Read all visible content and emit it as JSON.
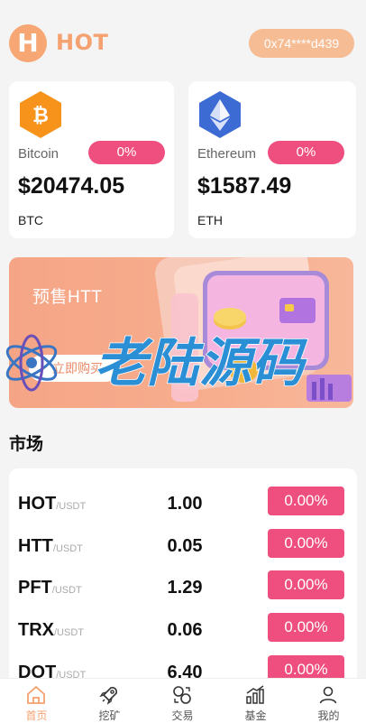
{
  "header": {
    "logo_letter": "H",
    "brand": "HOT",
    "wallet_address": "0x74****d439"
  },
  "coins": [
    {
      "name": "Bitcoin",
      "change": "0%",
      "price": "$20474.05",
      "symbol": "BTC",
      "icon": "bitcoin-icon",
      "color": "#f7931a"
    },
    {
      "name": "Ethereum",
      "change": "0%",
      "price": "$1587.49",
      "symbol": "ETH",
      "icon": "ethereum-icon",
      "color": "#3c6bd4"
    }
  ],
  "banner": {
    "title": "预售HTT",
    "button": "立即购买"
  },
  "watermark": {
    "text": "老陆源码"
  },
  "market": {
    "title": "市场",
    "rows": [
      {
        "base": "HOT",
        "quote": "/USDT",
        "price": "1.00",
        "change": "0.00%"
      },
      {
        "base": "HTT",
        "quote": "/USDT",
        "price": "0.05",
        "change": "0.00%"
      },
      {
        "base": "PFT",
        "quote": "/USDT",
        "price": "1.29",
        "change": "0.00%"
      },
      {
        "base": "TRX",
        "quote": "/USDT",
        "price": "0.06",
        "change": "0.00%"
      },
      {
        "base": "DOT",
        "quote": "/USDT",
        "price": "6.40",
        "change": "0.00%"
      }
    ]
  },
  "nav": {
    "items": [
      {
        "label": "首页",
        "icon": "home-icon"
      },
      {
        "label": "挖矿",
        "icon": "rocket-icon"
      },
      {
        "label": "交易",
        "icon": "exchange-icon"
      },
      {
        "label": "基金",
        "icon": "fund-chart-icon"
      },
      {
        "label": "我的",
        "icon": "profile-icon"
      }
    ]
  },
  "colors": {
    "accent": "#f5a170",
    "badge_pink": "#ef4f7e",
    "wallet_bg": "#f6bc93",
    "page_bg": "#f4f4f5"
  }
}
